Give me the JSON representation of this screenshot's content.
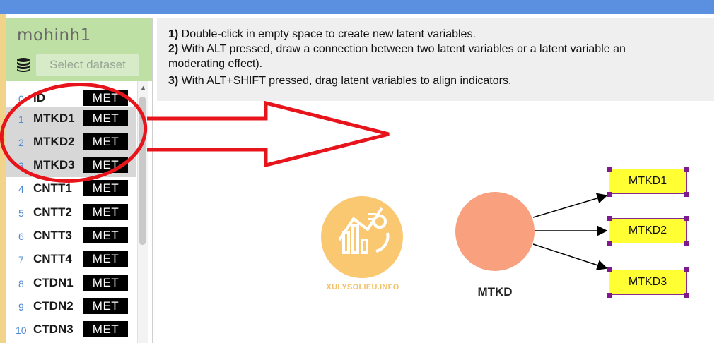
{
  "project": {
    "title": "mohinh1",
    "select_dataset_label": "Select dataset"
  },
  "variables": [
    {
      "index": "0",
      "name": "ID",
      "tag": "MET",
      "selected": false
    },
    {
      "index": "1",
      "name": "MTKD1",
      "tag": "MET",
      "selected": true
    },
    {
      "index": "2",
      "name": "MTKD2",
      "tag": "MET",
      "selected": true
    },
    {
      "index": "3",
      "name": "MTKD3",
      "tag": "MET",
      "selected": true
    },
    {
      "index": "4",
      "name": "CNTT1",
      "tag": "MET",
      "selected": false
    },
    {
      "index": "5",
      "name": "CNTT2",
      "tag": "MET",
      "selected": false
    },
    {
      "index": "6",
      "name": "CNTT3",
      "tag": "MET",
      "selected": false
    },
    {
      "index": "7",
      "name": "CNTT4",
      "tag": "MET",
      "selected": false
    },
    {
      "index": "8",
      "name": "CTDN1",
      "tag": "MET",
      "selected": false
    },
    {
      "index": "9",
      "name": "CTDN2",
      "tag": "MET",
      "selected": false
    },
    {
      "index": "10",
      "name": "CTDN3",
      "tag": "MET",
      "selected": false
    }
  ],
  "help": [
    {
      "num": "1)",
      "text": " Double-click in empty space to create new latent variables."
    },
    {
      "num": "2)",
      "text": " With ALT pressed, draw a connection between two latent variables or a latent variable an"
    },
    {
      "num": "",
      "text": "moderating effect)."
    },
    {
      "num": "3)",
      "text": " With ALT+SHIFT pressed, drag latent variables to align indicators."
    }
  ],
  "model": {
    "latent": {
      "name": "MTKD",
      "color": "#f9a07e"
    },
    "indicators": [
      {
        "name": "MTKD1"
      },
      {
        "name": "MTKD2"
      },
      {
        "name": "MTKD3"
      }
    ]
  },
  "watermark": {
    "text": "XULYSOLIEU.INFO",
    "color": "#f3c168"
  },
  "colors": {
    "accent_bar": "#5b8fe0",
    "project_header": "#bfe0a4",
    "indicator_fill": "#ffff33",
    "indicator_handle": "#7d1a8f",
    "annotation_red": "#e8141b"
  }
}
